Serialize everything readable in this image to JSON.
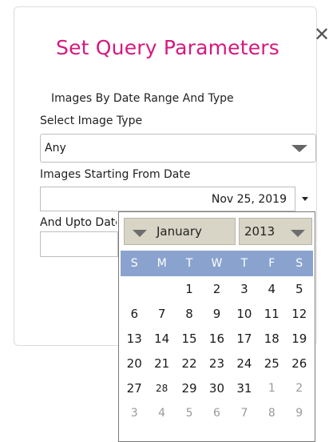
{
  "dialog": {
    "title": "Set Query Parameters",
    "close_glyph": "✕",
    "subheading": "Images By Date Range And Type",
    "image_type_label": "Select Image Type",
    "image_type_value": "Any",
    "start_date_label": "Images Starting From Date",
    "start_date_value": "Nov 25, 2019",
    "end_date_label": "And Upto Date",
    "end_date_value": ""
  },
  "calendar": {
    "month": "January",
    "year": "2013",
    "days_of_week": [
      "S",
      "M",
      "T",
      "W",
      "T",
      "F",
      "S"
    ],
    "weeks": [
      [
        {
          "d": ""
        },
        {
          "d": ""
        },
        {
          "d": "1"
        },
        {
          "d": "2"
        },
        {
          "d": "3"
        },
        {
          "d": "4"
        },
        {
          "d": "5"
        }
      ],
      [
        {
          "d": "6"
        },
        {
          "d": "7"
        },
        {
          "d": "8"
        },
        {
          "d": "9"
        },
        {
          "d": "10"
        },
        {
          "d": "11"
        },
        {
          "d": "12"
        }
      ],
      [
        {
          "d": "13"
        },
        {
          "d": "14"
        },
        {
          "d": "15"
        },
        {
          "d": "16"
        },
        {
          "d": "17"
        },
        {
          "d": "18"
        },
        {
          "d": "19"
        }
      ],
      [
        {
          "d": "20"
        },
        {
          "d": "21"
        },
        {
          "d": "22"
        },
        {
          "d": "23"
        },
        {
          "d": "24"
        },
        {
          "d": "25"
        },
        {
          "d": "26"
        }
      ],
      [
        {
          "d": "27"
        },
        {
          "d": "28",
          "small": true
        },
        {
          "d": "29"
        },
        {
          "d": "30"
        },
        {
          "d": "31"
        },
        {
          "d": "1",
          "other": true
        },
        {
          "d": "2",
          "other": true
        }
      ],
      [
        {
          "d": "3",
          "other": true
        },
        {
          "d": "4",
          "other": true
        },
        {
          "d": "5",
          "other": true
        },
        {
          "d": "6",
          "other": true
        },
        {
          "d": "7",
          "other": true
        },
        {
          "d": "8",
          "other": true
        },
        {
          "d": "9",
          "other": true
        }
      ]
    ]
  },
  "colors": {
    "title": "#d6197e",
    "calendar_header": "#8aa3ce",
    "select_bg": "#d8d4c6"
  }
}
